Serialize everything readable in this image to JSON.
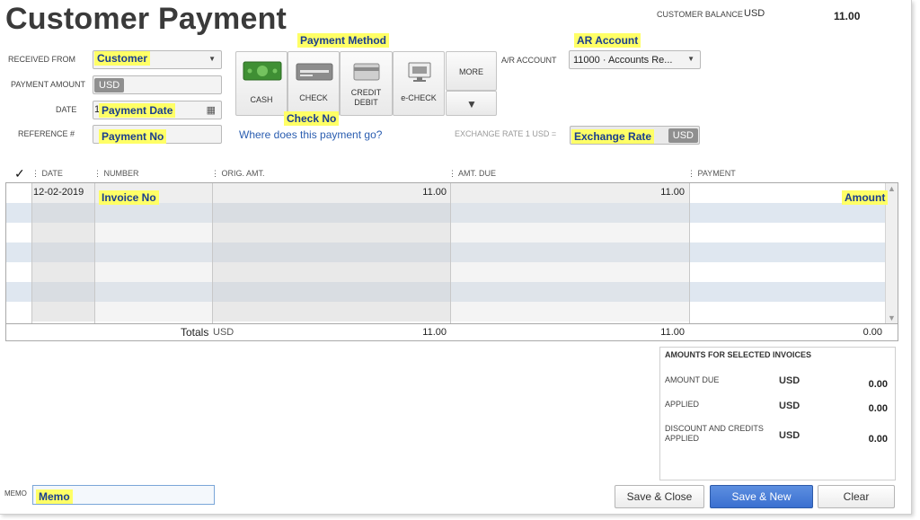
{
  "header": {
    "title": "Customer Payment",
    "balance_label": "CUSTOMER BALANCE",
    "balance_currency": "USD",
    "balance_value": "11.00"
  },
  "annotations": {
    "customer": "Customer",
    "payment_method": "Payment Method",
    "ar_account": "AR Account",
    "payment_date": "Payment Date",
    "payment_no": "Payment No",
    "check_no": "Check No",
    "exchange_rate": "Exchange Rate",
    "invoice_no": "Invoice No",
    "amount": "Amount",
    "memo": "Memo"
  },
  "form": {
    "received_from_label": "RECEIVED FROM",
    "payment_amount_label": "PAYMENT AMOUNT",
    "payment_amount_currency": "USD",
    "date_label": "DATE",
    "date_prefix": "1",
    "reference_label": "REFERENCE #",
    "where_link": "Where does this payment go?",
    "ar_account_label": "A/R ACCOUNT",
    "ar_account_value": "11000 · Accounts Re...",
    "exchange_rate_label": "EXCHANGE RATE 1 USD =",
    "exchange_currency": "USD"
  },
  "payment_methods": [
    {
      "label": "CASH"
    },
    {
      "label": "CHECK"
    },
    {
      "label": "CREDIT\nDEBIT"
    },
    {
      "label": "e-CHECK"
    },
    {
      "label": "MORE"
    }
  ],
  "table": {
    "check_header": "✓",
    "headers": [
      "DATE",
      "NUMBER",
      "ORIG. AMT.",
      "AMT. DUE",
      "PAYMENT"
    ],
    "rows": [
      {
        "date": "12-02-2019",
        "number": "",
        "orig_amt": "11.00",
        "amt_due": "11.00",
        "payment": ""
      }
    ],
    "totals_label": "Totals",
    "totals_currency": "USD",
    "totals_orig": "11.00",
    "totals_due": "11.00",
    "totals_payment": "0.00"
  },
  "summary": {
    "title": "AMOUNTS FOR SELECTED INVOICES",
    "items": [
      {
        "label": "AMOUNT DUE",
        "currency": "USD",
        "value": "0.00"
      },
      {
        "label": "APPLIED",
        "currency": "USD",
        "value": "0.00"
      },
      {
        "label": "DISCOUNT AND CREDITS APPLIED",
        "currency": "USD",
        "value": "0.00"
      }
    ]
  },
  "memo_label": "MEMO",
  "buttons": {
    "save_close": "Save & Close",
    "save_new": "Save & New",
    "clear": "Clear"
  },
  "colors": {
    "highlight": "#ffff66",
    "annotation_text": "#1a3d8f",
    "link": "#2a5db0",
    "primary_button": "#3a6fd0",
    "alt_row": "#dfe7f0"
  }
}
